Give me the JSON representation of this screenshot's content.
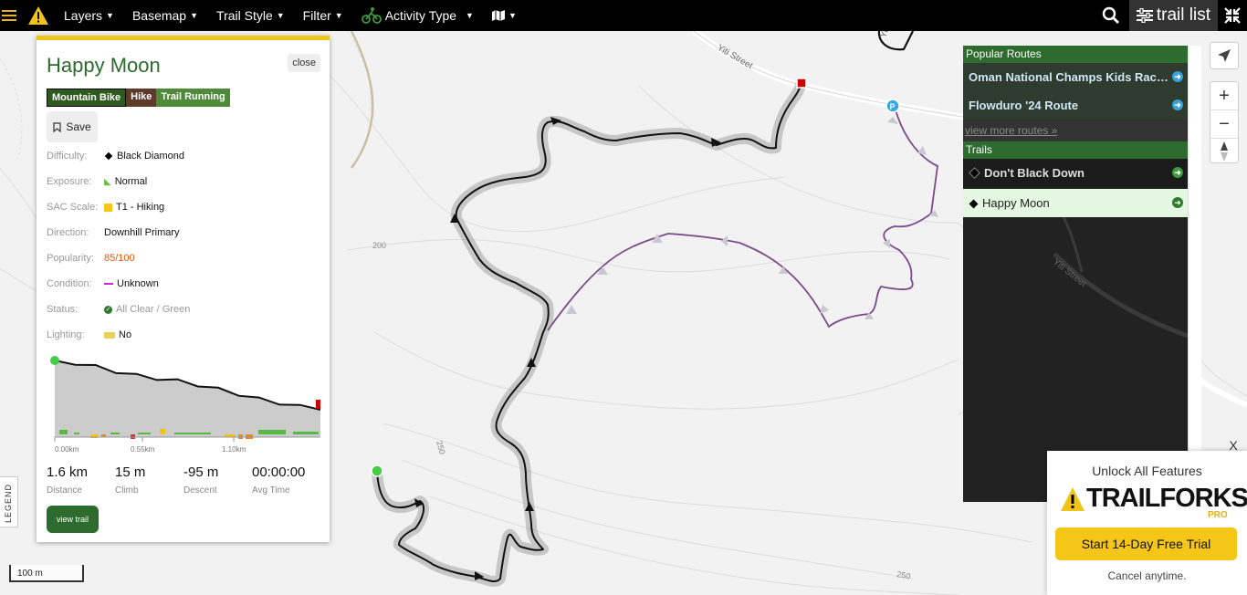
{
  "nav": {
    "layers": "Layers",
    "basemap": "Basemap",
    "trail_style": "Trail Style",
    "filter": "Filter",
    "activity_type": "Activity Type",
    "trail_list": "trail list",
    "icons": {
      "menu": "hamburger-icon",
      "logo": "warning-triangle-logo",
      "activity": "mountain-biker-icon",
      "map": "map-icon",
      "search": "search-icon",
      "trail_list": "sliders-icon",
      "expand": "collapse-arrows-icon"
    },
    "accent": "#e8b41c"
  },
  "trail_card": {
    "title": "Happy Moon",
    "close": "close",
    "tags": [
      "Mountain Bike",
      "Hike",
      "Trail Running"
    ],
    "save": "Save",
    "attributes": {
      "difficulty_label": "Difficulty:",
      "difficulty": "Black Diamond",
      "exposure_label": "Exposure:",
      "exposure": "Normal",
      "sac_label": "SAC Scale:",
      "sac": "T1 - Hiking",
      "direction_label": "Direction:",
      "direction": "Downhill Primary",
      "popularity_label": "Popularity:",
      "popularity": "85/100",
      "condition_label": "Condition:",
      "condition": "Unknown",
      "status_label": "Status:",
      "status": "All Clear / Green",
      "lighting_label": "Lighting:",
      "lighting": "No"
    },
    "elevation_chart": {
      "x_ticks": [
        "0.00km",
        "0.55km",
        "1.10km"
      ],
      "profile": [
        0.0,
        0.05,
        0.12,
        0.22,
        0.3,
        0.36,
        0.41,
        0.49,
        0.58,
        0.68,
        0.78,
        0.86,
        0.93,
        1.0
      ],
      "colors": {
        "line": "#111111",
        "fill": "#cccccc",
        "start": "#44cc44",
        "end": "#cc0000"
      }
    },
    "stats": {
      "distance": "1.6 km",
      "distance_label": "Distance",
      "climb": "15 m",
      "climb_label": "Climb",
      "descent": "-95 m",
      "descent_label": "Descent",
      "avg_time": "00:00:00",
      "avg_time_label": "Avg Time"
    },
    "view_trail": "view trail"
  },
  "legend": "LEGEND",
  "scale": "100 m",
  "map_labels": {
    "street_1": "Yiti Street",
    "street_2": "Yiti Street",
    "street_3": "Yiti",
    "contour_200": "200",
    "contour_250a": "250",
    "contour_250b": "250",
    "parking": "P"
  },
  "right_panel": {
    "popular_routes_header": "Popular Routes",
    "routes": [
      "Oman National Champs Kids Race R...",
      "Flowduro '24 Route"
    ],
    "view_more": "view more routes »",
    "trails_header": "Trails",
    "trails": [
      "Don't Black Down",
      "Happy Moon"
    ]
  },
  "map_controls": {
    "zoom_in": "+",
    "zoom_out": "−"
  },
  "promo": {
    "close": "X",
    "title": "Unlock All Features",
    "brand": "TRAILFORKS",
    "pro": "PRO",
    "cta": "Start 14-Day Free Trial",
    "sub": "Cancel anytime."
  }
}
